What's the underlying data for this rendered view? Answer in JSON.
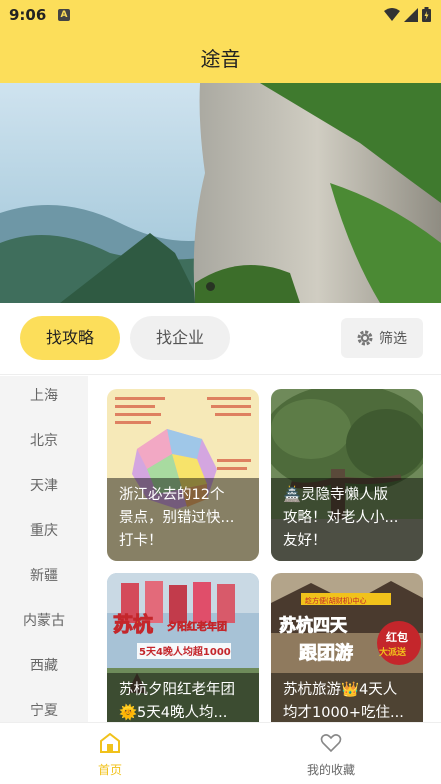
{
  "status_bar": {
    "time": "9:06",
    "notification_icon": "A"
  },
  "header": {
    "title": "途音"
  },
  "filters": {
    "tabs": [
      {
        "label": "找攻略",
        "active": true
      },
      {
        "label": "找企业",
        "active": false
      }
    ],
    "filter_label": "筛选"
  },
  "sidebar": {
    "cities": [
      "上海",
      "北京",
      "天津",
      "重庆",
      "新疆",
      "内蒙古",
      "西藏",
      "宁夏"
    ]
  },
  "cards": [
    {
      "title": "浙江必去的12个景点，别错过快乐打卡！",
      "lines": [
        "浙江必去的12个",
        "景点，别错过快...",
        "打卡！"
      ]
    },
    {
      "title": "🏯灵隐寺懒人版攻略！对老人小...友好！",
      "lines": [
        "🏯灵隐寺懒人版",
        "攻略！对老人小...",
        "友好！"
      ]
    },
    {
      "title": "苏杭夕阳红老年团🌞5天4晚人均...",
      "lines": [
        "苏杭夕阳红老年团",
        "🌞5天4晚人均..."
      ],
      "image_text": [
        "苏杭",
        "夕阳红老年团",
        "5天4晚人均超1000"
      ]
    },
    {
      "title": "苏杭旅游👑4天人均才1000+吃住...",
      "lines": [
        "苏杭旅游👑4天人",
        "均才1000+吃住..."
      ],
      "image_text": [
        "趁方便(胡财机)中心",
        "苏杭四天",
        "跟团游",
        "红包",
        "大派送"
      ]
    }
  ],
  "tabbar": {
    "items": [
      {
        "label": "首页",
        "active": true
      },
      {
        "label": "我的收藏",
        "active": false
      }
    ]
  },
  "colors": {
    "brand": "#fcde5a",
    "accent_text": "#f1c21b"
  }
}
